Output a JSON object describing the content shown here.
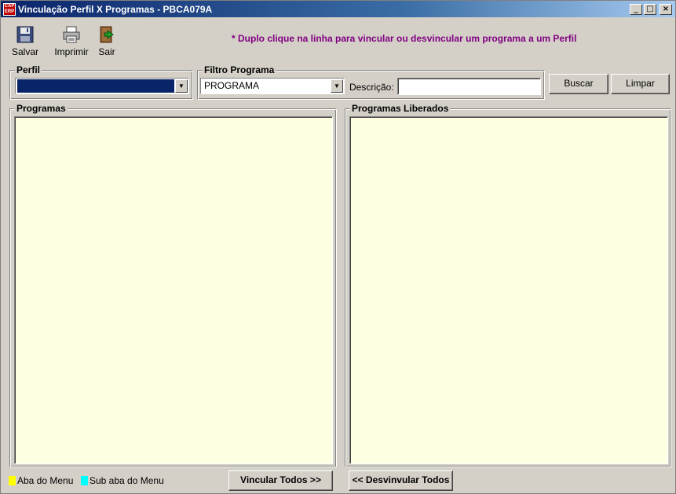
{
  "window": {
    "app_icon_text": "CAP ERP",
    "title": "Vinculação Perfil X Programas - PBCA079A",
    "controls": {
      "minimize": "_",
      "maximize": "□",
      "close": "×"
    }
  },
  "toolbar": {
    "save_label": "Salvar",
    "print_label": "Imprimir",
    "exit_label": "Sair",
    "hint": "* Duplo clique na linha para vincular ou desvincular um programa a um Perfil"
  },
  "perfil": {
    "group_label": "Perfil",
    "selected_value": ""
  },
  "filtro": {
    "group_label": "Filtro Programa",
    "selected_value": "PROGRAMA",
    "description_label": "Descrição:",
    "description_value": ""
  },
  "actions": {
    "search_label": "Buscar",
    "clear_label": "Limpar"
  },
  "programas": {
    "group_label": "Programas",
    "items": []
  },
  "liberados": {
    "group_label": "Programas Liberados",
    "items": []
  },
  "legend": {
    "menu_tab": "Aba do Menu",
    "menu_tab_color": "#ffff00",
    "sub_tab": "Sub aba do Menu",
    "sub_tab_color": "#00ffff"
  },
  "bottom": {
    "link_all_label": "Vincular Todos >>",
    "unlink_all_label": "<< Desvinvular Todos"
  },
  "colors": {
    "list_background": "#ffffe1",
    "hint_color": "#800080",
    "selection_navy": "#0a246a"
  }
}
